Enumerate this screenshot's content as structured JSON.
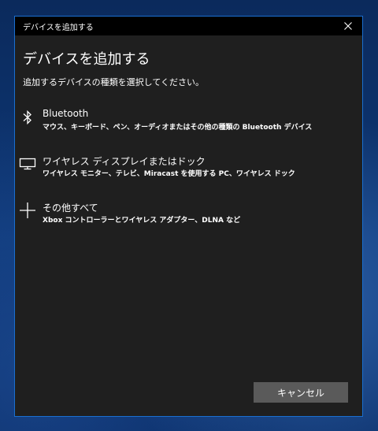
{
  "window": {
    "title": "デバイスを追加する",
    "close_icon": "close-icon"
  },
  "main": {
    "heading": "デバイスを追加する",
    "subtitle": "追加するデバイスの種類を選択してください。"
  },
  "options": [
    {
      "icon": "bluetooth-icon",
      "title": "Bluetooth",
      "description": "マウス、キーボード、ペン、オーディオまたはその他の種類の Bluetooth デバイス"
    },
    {
      "icon": "monitor-icon",
      "title": "ワイヤレス ディスプレイまたはドック",
      "description": "ワイヤレス モニター、テレビ、Miracast を使用する PC、ワイヤレス ドック"
    },
    {
      "icon": "plus-icon",
      "title": "その他すべて",
      "description": "Xbox コントローラーとワイヤレス アダプター、DLNA など"
    }
  ],
  "footer": {
    "cancel_label": "キャンセル"
  },
  "colors": {
    "dialog_background": "#1f1f1f",
    "titlebar_background": "#000000",
    "border_accent": "#1a6fd0",
    "button_background": "#5a5a5a",
    "text": "#ffffff"
  }
}
